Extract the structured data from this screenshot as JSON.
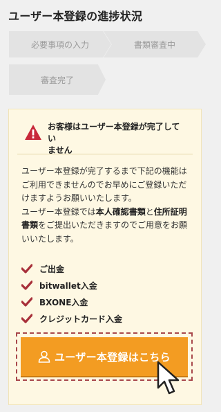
{
  "page": {
    "title": "ユーザー本登録の進捗状況"
  },
  "progress": {
    "steps": [
      {
        "label": "必要事項の入力",
        "status": "inactive"
      },
      {
        "label": "書類審査中",
        "status": "inactive"
      },
      {
        "label": "審査完了",
        "status": "inactive"
      }
    ]
  },
  "notice": {
    "alert_line1": "お客様はユーザー本登録が完了してい",
    "alert_line2": "ません",
    "alert_icon": "warning-triangle-icon",
    "para1": "ユーザー本登録が完了するまで下記の機能はご利用できませんのでお早めにご登録いただけますようお願いいたします。",
    "para2_prefix": "ユーザー本登録では",
    "para2_bold1": "本人確認書類",
    "para2_mid": "と",
    "para2_bold2": "住所証明書類",
    "para2_suffix": "をご提出いただきますのでご用意をお願いいたします。",
    "features": [
      "ご出金",
      "bitwallet入金",
      "BXONE入金",
      "クレジットカード入金"
    ],
    "cta_label": "ユーザー本登録はこちら"
  },
  "colors": {
    "accent": "#f39c22",
    "check": "#a8303a",
    "card_bg": "#fef8e3",
    "outline": "#a8474b"
  }
}
